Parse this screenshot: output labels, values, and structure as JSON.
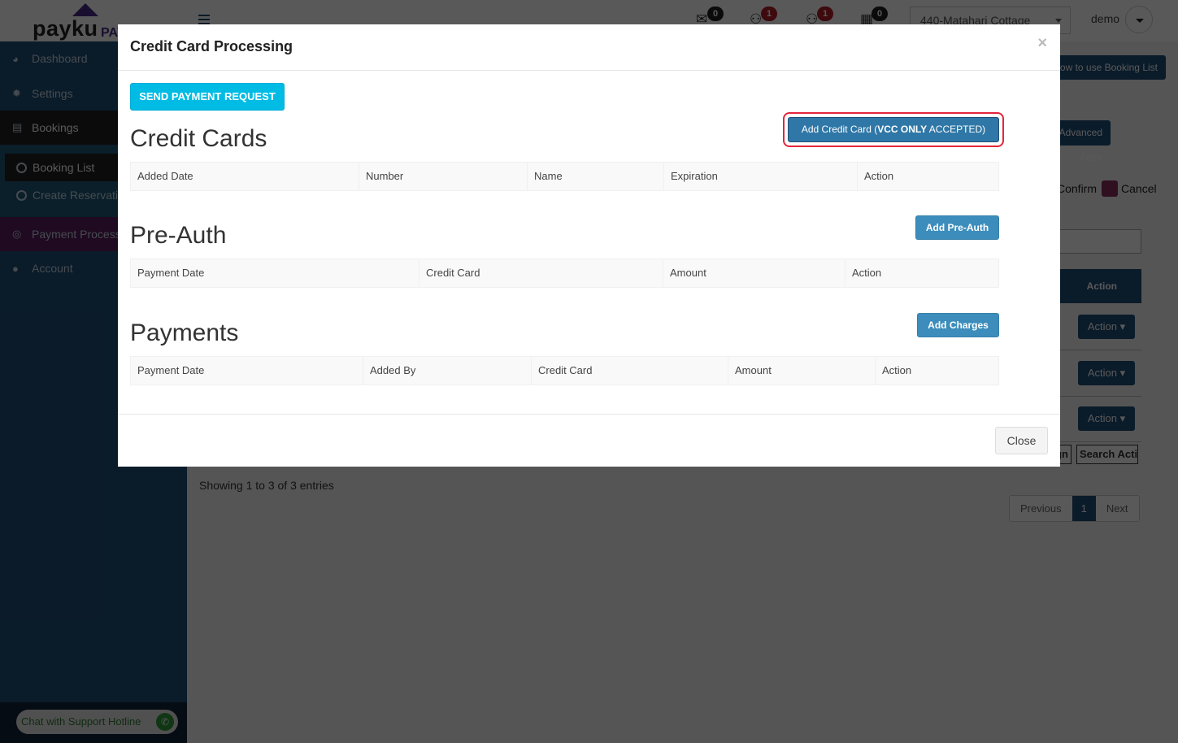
{
  "app": {
    "logo_text": "payku",
    "logo_sub": "PAY"
  },
  "topbar": {
    "notifications": [
      {
        "icon": "envelope-open-icon",
        "glyph": "✉",
        "count": "0",
        "badge_color": "#222222"
      },
      {
        "icon": "check-in-icon",
        "glyph": "⚇",
        "count": "1",
        "badge_color": "#b11f2a"
      },
      {
        "icon": "check-out-icon",
        "glyph": "⚇",
        "count": "1",
        "badge_color": "#b11f2a"
      },
      {
        "icon": "calendar-icon",
        "glyph": "▦",
        "count": "0",
        "badge_color": "#222222"
      }
    ],
    "property_select": "440-Matahari Cottage",
    "user_name": "demo"
  },
  "sidebar": {
    "items": [
      {
        "label": "Dashboard",
        "icon": "dashboard-icon",
        "glyph": "◕"
      },
      {
        "label": "Settings",
        "icon": "gear-icon",
        "glyph": "✹"
      },
      {
        "label": "Bookings",
        "icon": "bookings-icon",
        "glyph": "▤"
      },
      {
        "label": "Payment Processing",
        "icon": "payment-icon",
        "glyph": "◎"
      },
      {
        "label": "Account",
        "icon": "user-icon",
        "glyph": "●"
      }
    ],
    "sub_items": [
      {
        "label": "Booking List"
      },
      {
        "label": "Create Reservation"
      }
    ],
    "chat_label": "Chat with Support Hotline"
  },
  "background": {
    "howto_label": "How to use Booking List",
    "filter_label": "Advanced Filter",
    "legend_confirm": "Confirm",
    "legend_cancel": "Cancel",
    "legend_cancel_color": "#8a2c5e",
    "table_action_header": "Action",
    "row_action_label": "Action ▾",
    "footer_buttons": [
      "Design",
      "Search Action"
    ],
    "showing_text": "Showing 1 to 3 of 3 entries",
    "pager": {
      "previous": "Previous",
      "current": "1",
      "next": "Next"
    }
  },
  "modal": {
    "title": "Credit Card Processing",
    "close_x": "×",
    "send_payment_request": "SEND PAYMENT REQUEST",
    "credit_cards": {
      "title": "Credit Cards",
      "add_button_prefix": "Add Credit Card (",
      "add_button_bold": "VCC ONLY",
      "add_button_suffix": " ACCEPTED)",
      "columns": [
        "Added Date",
        "Number",
        "Name",
        "Expiration",
        "Action"
      ]
    },
    "pre_auth": {
      "title": "Pre-Auth",
      "add_button": "Add Pre-Auth",
      "columns": [
        "Payment Date",
        "Credit Card",
        "Amount",
        "Action"
      ]
    },
    "payments": {
      "title": "Payments",
      "add_button": "Add Charges",
      "columns": [
        "Payment Date",
        "Added By",
        "Credit Card",
        "Amount",
        "Action"
      ]
    },
    "close_button": "Close"
  },
  "colors": {
    "primary": "#3c8dbc",
    "info": "#00bce4",
    "highlight": "#e5243b",
    "sidebar": "#1f4e78"
  }
}
